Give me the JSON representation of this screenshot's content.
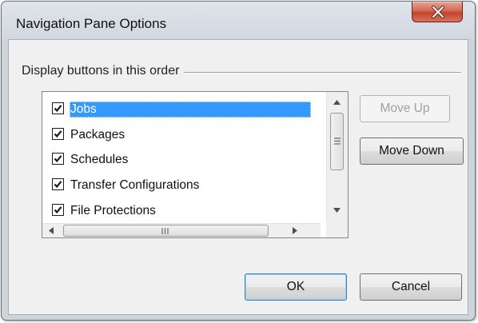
{
  "window": {
    "title": "Navigation Pane Options"
  },
  "group": {
    "label": "Display buttons in this order"
  },
  "list": {
    "items": [
      {
        "label": "Jobs",
        "checked": true,
        "selected": true
      },
      {
        "label": "Packages",
        "checked": true,
        "selected": false
      },
      {
        "label": "Schedules",
        "checked": true,
        "selected": false
      },
      {
        "label": "Transfer Configurations",
        "checked": true,
        "selected": false
      },
      {
        "label": "File Protections",
        "checked": true,
        "selected": false
      }
    ]
  },
  "buttons": {
    "move_up": "Move Up",
    "move_down": "Move Down",
    "ok": "OK",
    "cancel": "Cancel"
  },
  "colors": {
    "selection": "#3399ff",
    "close_button": "#c4422b"
  },
  "icons": {
    "close": "close-x-icon",
    "check": "checkmark-icon"
  }
}
